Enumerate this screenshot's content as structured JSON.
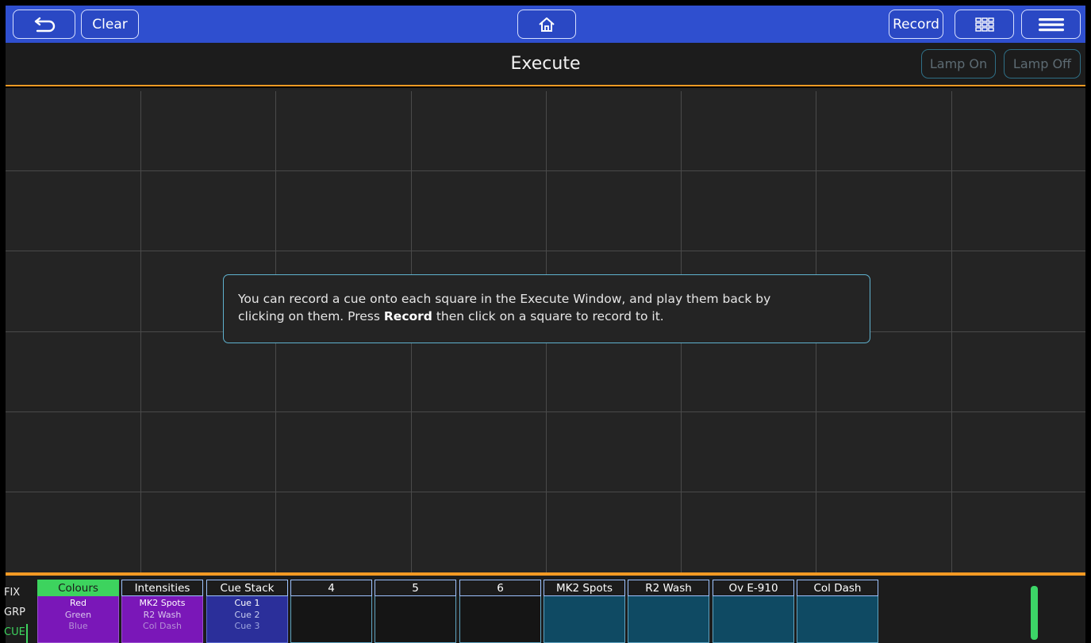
{
  "toolbar": {
    "clear_label": "Clear",
    "record_label": "Record"
  },
  "title_bar": {
    "title": "Execute",
    "lamp_on_label": "Lamp On",
    "lamp_off_label": "Lamp Off"
  },
  "info": {
    "line1": "You can record a cue onto each square in the Execute Window, and play them back by",
    "line2_before": "clicking on them. Press ",
    "line2_bold": "Record",
    "line2_after": " then click on a square to record to it."
  },
  "modes": [
    "FIX",
    "GRP",
    "CUE"
  ],
  "playbacks": [
    {
      "label": "Colours",
      "items": [
        "Red",
        "Green",
        "Blue"
      ]
    },
    {
      "label": "Intensities",
      "items": [
        "MK2 Spots",
        "R2 Wash",
        "Col Dash"
      ]
    },
    {
      "label": "Cue Stack",
      "items": [
        "Cue 1",
        "Cue 2",
        "Cue 3"
      ]
    },
    {
      "label": "4",
      "items": []
    },
    {
      "label": "5",
      "items": []
    },
    {
      "label": "6",
      "items": []
    },
    {
      "label": "MK2 Spots",
      "items": []
    },
    {
      "label": "R2 Wash",
      "items": []
    },
    {
      "label": "Ov E-910",
      "items": []
    },
    {
      "label": "Col Dash",
      "items": []
    }
  ],
  "colors": {
    "topbar": "#2f4fcf",
    "accent": "#f39a24",
    "active_green": "#3dd35e",
    "colours_body": "#7a17b8",
    "cuestack_body": "#2b2f9a",
    "fixture_body": "#0f4a63"
  },
  "icons": {
    "back": "back-arrow-icon",
    "home": "home-icon",
    "grid": "grid-view-icon",
    "menu": "hamburger-menu-icon"
  }
}
